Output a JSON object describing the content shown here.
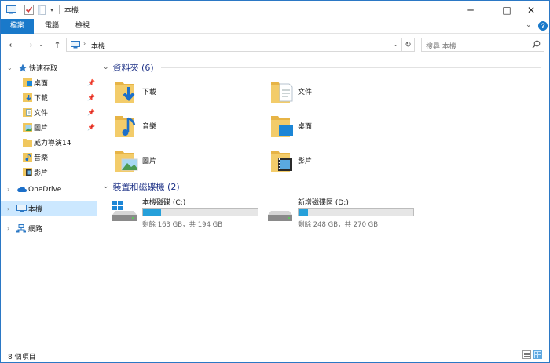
{
  "window": {
    "title": "本機"
  },
  "window_controls": {
    "minimize": "─",
    "maximize": "□",
    "close": "✕"
  },
  "ribbon": {
    "tabs": [
      {
        "label": "檔案",
        "active": true
      },
      {
        "label": "電腦"
      },
      {
        "label": "檢視"
      }
    ]
  },
  "address": {
    "path": "本機",
    "search_placeholder": "搜尋 本機"
  },
  "sidebar": {
    "quick_access": "快速存取",
    "items": [
      {
        "label": "桌面",
        "pinned": true
      },
      {
        "label": "下載",
        "pinned": true
      },
      {
        "label": "文件",
        "pinned": true
      },
      {
        "label": "圖片",
        "pinned": true
      },
      {
        "label": "威力導演14",
        "pinned": false
      },
      {
        "label": "音樂",
        "pinned": false
      },
      {
        "label": "影片",
        "pinned": false
      }
    ],
    "onedrive": "OneDrive",
    "this_pc": "本機",
    "network": "網路"
  },
  "content": {
    "folders_header": "資料夾 (6)",
    "folders": [
      {
        "label": "下載",
        "icon": "downloads-folder-icon"
      },
      {
        "label": "文件",
        "icon": "documents-folder-icon"
      },
      {
        "label": "音樂",
        "icon": "music-folder-icon"
      },
      {
        "label": "桌面",
        "icon": "desktop-folder-icon"
      },
      {
        "label": "圖片",
        "icon": "pictures-folder-icon"
      },
      {
        "label": "影片",
        "icon": "videos-folder-icon"
      }
    ],
    "drives_header": "裝置和磁碟機 (2)",
    "drives": [
      {
        "name": "本機磁碟 (C:)",
        "free_text": "剩餘 163 GB，共 194 GB",
        "used_fraction": 0.16
      },
      {
        "name": "新增磁碟區 (D:)",
        "free_text": "剩餘 248 GB，共 270 GB",
        "used_fraction": 0.08
      }
    ]
  },
  "status": {
    "item_count": "8 個項目"
  },
  "colors": {
    "accent": "#1979ca",
    "header_text": "#1e3287",
    "selection": "#cce8ff",
    "drive_bar": "#26a0da",
    "folder": "#f0c75e"
  }
}
